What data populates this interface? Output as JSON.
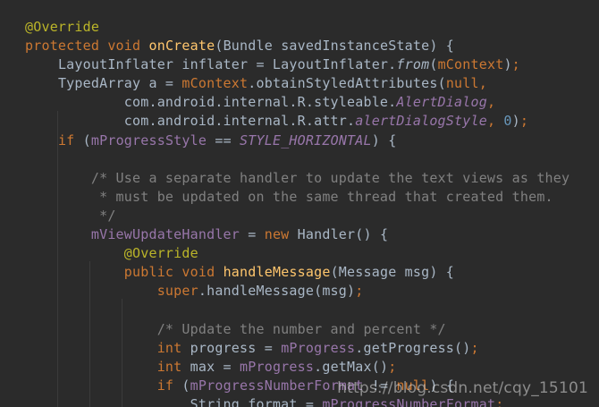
{
  "lines": [
    {
      "indent": 0,
      "tokens": [
        {
          "t": "@Override",
          "c": "ann"
        }
      ]
    },
    {
      "indent": 0,
      "tokens": [
        {
          "t": "protected",
          "c": "kw"
        },
        {
          "t": " "
        },
        {
          "t": "void",
          "c": "kw"
        },
        {
          "t": " "
        },
        {
          "t": "onCreate",
          "c": "fn"
        },
        {
          "t": "(Bundle savedInstanceState) {"
        }
      ]
    },
    {
      "indent": 1,
      "tokens": [
        {
          "t": "LayoutInflater inflater = LayoutInflater."
        },
        {
          "t": "from",
          "c": "it"
        },
        {
          "t": "("
        },
        {
          "t": "mContext",
          "c": "kw"
        },
        {
          "t": ")"
        },
        {
          "t": ";",
          "c": "kw"
        }
      ]
    },
    {
      "indent": 1,
      "tokens": [
        {
          "t": "TypedArray a = "
        },
        {
          "t": "mContext",
          "c": "kw"
        },
        {
          "t": ".obtainStyledAttributes("
        },
        {
          "t": "null",
          "c": "kw"
        },
        {
          "t": ",",
          "c": "kw"
        }
      ]
    },
    {
      "indent": 3,
      "tokens": [
        {
          "t": "com.android.internal.R.styleable."
        },
        {
          "t": "AlertDialog",
          "c": "static"
        },
        {
          "t": ",",
          "c": "kw"
        }
      ]
    },
    {
      "indent": 3,
      "tokens": [
        {
          "t": "com.android.internal.R.attr."
        },
        {
          "t": "alertDialogStyle",
          "c": "static"
        },
        {
          "t": ",",
          "c": "kw"
        },
        {
          "t": " "
        },
        {
          "t": "0",
          "c": "num"
        },
        {
          "t": ")"
        },
        {
          "t": ";",
          "c": "kw"
        }
      ]
    },
    {
      "indent": 1,
      "tokens": [
        {
          "t": "if",
          "c": "kw"
        },
        {
          "t": " ("
        },
        {
          "t": "mProgressStyle",
          "c": "field"
        },
        {
          "t": " == "
        },
        {
          "t": "STYLE_HORIZONTAL",
          "c": "static"
        },
        {
          "t": ") {"
        }
      ]
    },
    {
      "indent": 0,
      "tokens": []
    },
    {
      "indent": 2,
      "tokens": [
        {
          "t": "/* Use a separate handler to update the text views as they",
          "c": "com"
        }
      ]
    },
    {
      "indent": 2,
      "tokens": [
        {
          "t": " * must be updated on the same thread that created them.",
          "c": "com"
        }
      ]
    },
    {
      "indent": 2,
      "tokens": [
        {
          "t": " */",
          "c": "com"
        }
      ]
    },
    {
      "indent": 2,
      "tokens": [
        {
          "t": "mViewUpdateHandler",
          "c": "field"
        },
        {
          "t": " = "
        },
        {
          "t": "new",
          "c": "kw"
        },
        {
          "t": " Handler() {"
        }
      ]
    },
    {
      "indent": 3,
      "tokens": [
        {
          "t": "@Override",
          "c": "ann"
        }
      ]
    },
    {
      "indent": 3,
      "tokens": [
        {
          "t": "public",
          "c": "kw"
        },
        {
          "t": " "
        },
        {
          "t": "void",
          "c": "kw"
        },
        {
          "t": " "
        },
        {
          "t": "handleMessage",
          "c": "fn"
        },
        {
          "t": "(Message msg) {"
        }
      ]
    },
    {
      "indent": 4,
      "tokens": [
        {
          "t": "super",
          "c": "kw"
        },
        {
          "t": ".handleMessage(msg)"
        },
        {
          "t": ";",
          "c": "kw"
        }
      ]
    },
    {
      "indent": 0,
      "tokens": []
    },
    {
      "indent": 4,
      "tokens": [
        {
          "t": "/* Update the number and percent */",
          "c": "com"
        }
      ]
    },
    {
      "indent": 4,
      "tokens": [
        {
          "t": "int",
          "c": "kw"
        },
        {
          "t": " progress = "
        },
        {
          "t": "mProgress",
          "c": "field"
        },
        {
          "t": ".getProgress()"
        },
        {
          "t": ";",
          "c": "kw"
        }
      ]
    },
    {
      "indent": 4,
      "tokens": [
        {
          "t": "int",
          "c": "kw"
        },
        {
          "t": " max = "
        },
        {
          "t": "mProgress",
          "c": "field"
        },
        {
          "t": ".getMax()"
        },
        {
          "t": ";",
          "c": "kw"
        }
      ]
    },
    {
      "indent": 4,
      "tokens": [
        {
          "t": "if",
          "c": "kw"
        },
        {
          "t": " ("
        },
        {
          "t": "mProgressNumberFormat",
          "c": "field"
        },
        {
          "t": " != "
        },
        {
          "t": "null",
          "c": "kw"
        },
        {
          "t": ") {"
        }
      ]
    },
    {
      "indent": 5,
      "tokens": [
        {
          "t": "String format = "
        },
        {
          "t": "mProgressNumberFormat",
          "c": "field"
        },
        {
          "t": ";",
          "c": "kw"
        }
      ]
    }
  ],
  "watermark": "https://blog.csdn.net/cqy_15101",
  "colors": {
    "background": "#2b2b2b",
    "text": "#a9b7c6",
    "keyword": "#cc7832",
    "annotation": "#bbb529",
    "method": "#ffc66d",
    "field": "#9876aa",
    "number": "#6897bb",
    "comment": "#808080"
  }
}
